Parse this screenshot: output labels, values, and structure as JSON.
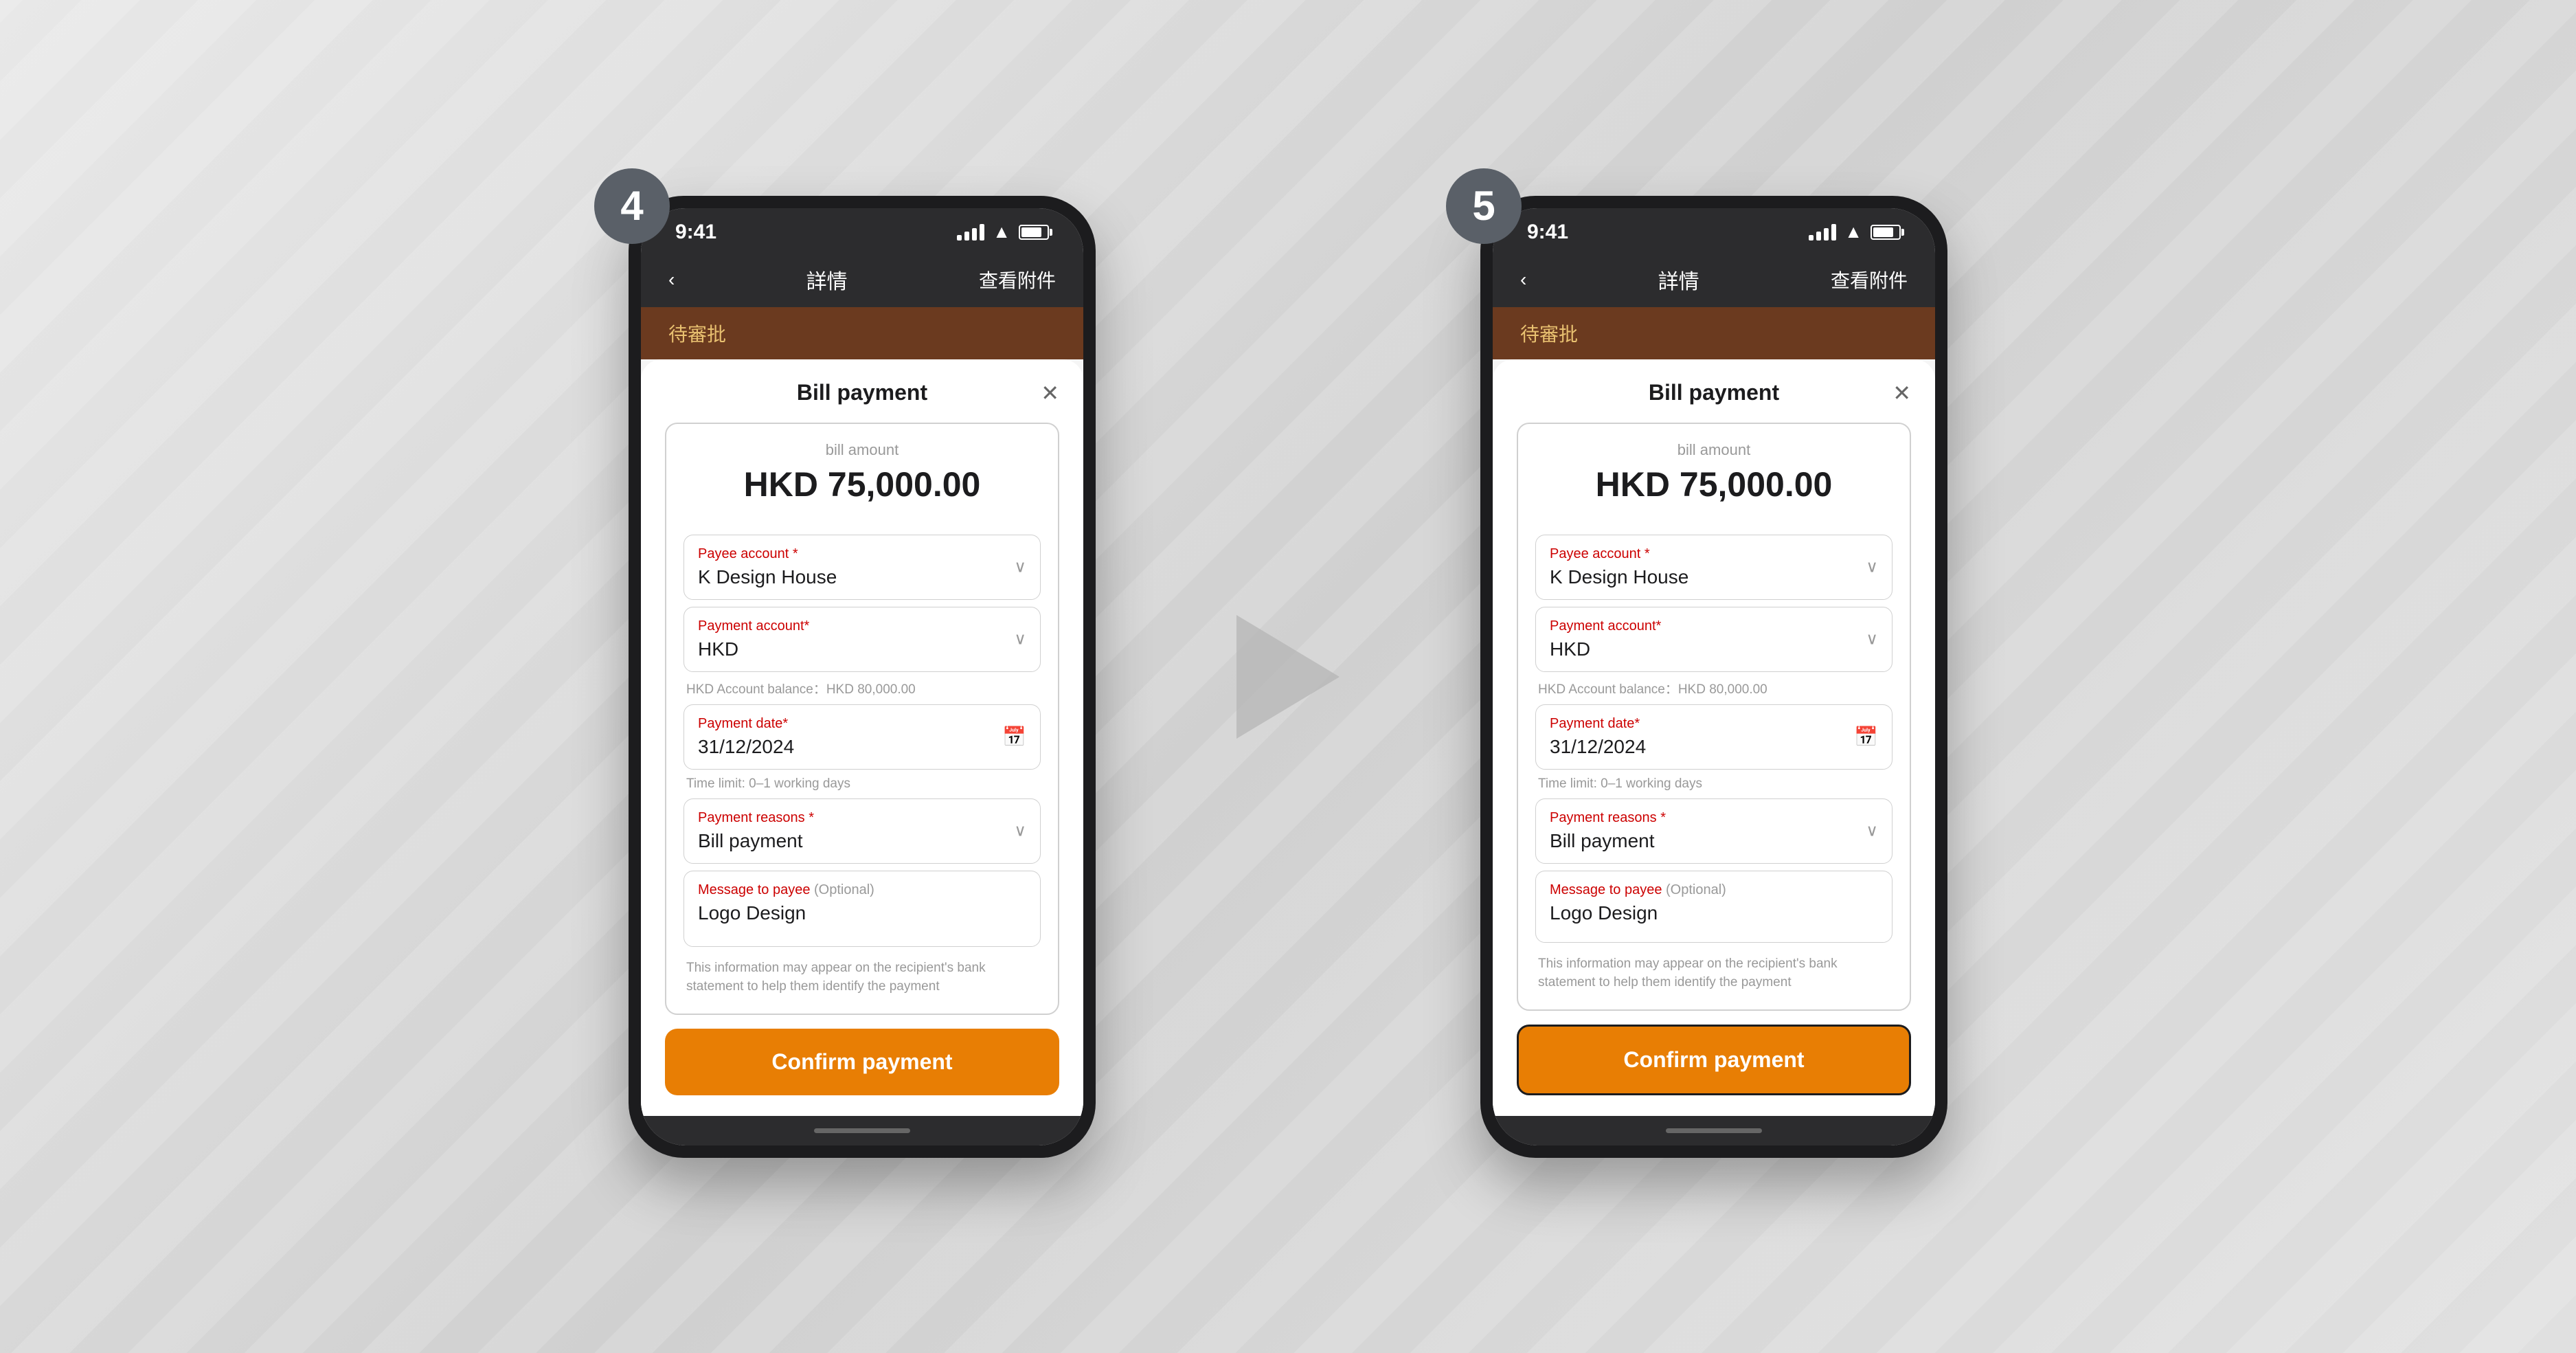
{
  "page": {
    "background": "#dcdcdc",
    "accent_color": "#e87e04"
  },
  "screen4": {
    "step_number": "4",
    "status_bar": {
      "time": "9:41",
      "signal": "signal",
      "wifi": "wifi",
      "battery": "battery"
    },
    "nav": {
      "back_label": "‹",
      "title": "詳情",
      "action": "查看附件"
    },
    "pending_banner": {
      "text": "待審批"
    },
    "modal": {
      "title": "Bill payment",
      "close_label": "✕",
      "bill_amount_label": "bill amount",
      "bill_amount_value": "HKD 75,000.00",
      "payee_account_label": "Payee account",
      "payee_account_value": "K Design House",
      "payment_account_label": "Payment account",
      "payment_account_value": "HKD",
      "account_balance_hint": "HKD Account balance：HKD 80,000.00",
      "payment_date_label": "Payment date",
      "payment_date_value": "31/12/2024",
      "time_limit_hint": "Time limit: 0–1 working days",
      "payment_reasons_label": "Payment reasons",
      "payment_reasons_value": "Bill payment",
      "message_label": "Message to payee",
      "message_optional": "(Optional)",
      "message_value": "Logo Design",
      "message_hint": "This information may appear on the recipient's bank statement to help them identify the payment",
      "confirm_button_label": "Confirm payment"
    }
  },
  "screen5": {
    "step_number": "5",
    "status_bar": {
      "time": "9:41",
      "signal": "signal",
      "wifi": "wifi",
      "battery": "battery"
    },
    "nav": {
      "back_label": "‹",
      "title": "詳情",
      "action": "查看附件"
    },
    "pending_banner": {
      "text": "待審批"
    },
    "modal": {
      "title": "Bill payment",
      "close_label": "✕",
      "bill_amount_label": "bill amount",
      "bill_amount_value": "HKD 75,000.00",
      "payee_account_label": "Payee account",
      "payee_account_value": "K Design House",
      "payment_account_label": "Payment account",
      "payment_account_value": "HKD",
      "account_balance_hint": "HKD Account balance：HKD 80,000.00",
      "payment_date_label": "Payment date",
      "payment_date_value": "31/12/2024",
      "time_limit_hint": "Time limit: 0–1 working days",
      "payment_reasons_label": "Payment reasons",
      "payment_reasons_value": "Bill payment",
      "message_label": "Message to payee",
      "message_optional": "(Optional)",
      "message_value": "Logo Design",
      "message_hint": "This information may appear on the recipient's bank statement to help them identify the payment",
      "confirm_button_label": "Confirm payment"
    }
  },
  "icons": {
    "chevron_down": "⌄",
    "calendar": "📅",
    "close": "✕",
    "back": "‹"
  }
}
